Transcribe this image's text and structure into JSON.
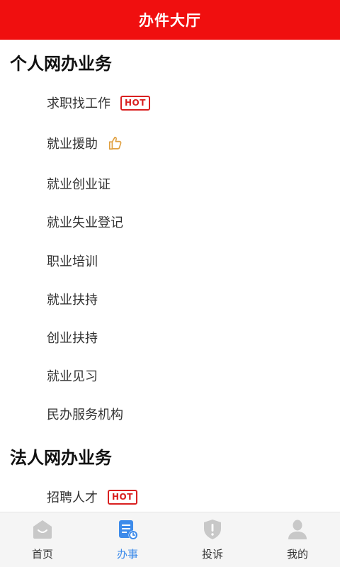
{
  "header": {
    "title": "办件大厅"
  },
  "sections": [
    {
      "title": "个人网办业务",
      "items": [
        {
          "label": "求职找工作",
          "badge": "HOT"
        },
        {
          "label": "就业援助",
          "icon": "thumbs-up-icon"
        },
        {
          "label": "就业创业证"
        },
        {
          "label": "就业失业登记"
        },
        {
          "label": "职业培训"
        },
        {
          "label": "就业扶持"
        },
        {
          "label": "创业扶持"
        },
        {
          "label": "就业见习"
        },
        {
          "label": "民办服务机构"
        }
      ]
    },
    {
      "title": "法人网办业务",
      "items": [
        {
          "label": "招聘人才",
          "badge": "HOT"
        }
      ]
    }
  ],
  "tabbar": {
    "active": "办事",
    "tabs": [
      {
        "label": "首页",
        "icon": "home-icon"
      },
      {
        "label": "办事",
        "icon": "document-clock-icon"
      },
      {
        "label": "投诉",
        "icon": "shield-alert-icon"
      },
      {
        "label": "我的",
        "icon": "user-icon"
      }
    ]
  },
  "colors": {
    "header_bg": "#f00f0f",
    "hot_badge": "#d92020",
    "thumb_icon": "#e0a040",
    "active_tab": "#3d8bea",
    "inactive_icon": "#c8c8c8"
  }
}
